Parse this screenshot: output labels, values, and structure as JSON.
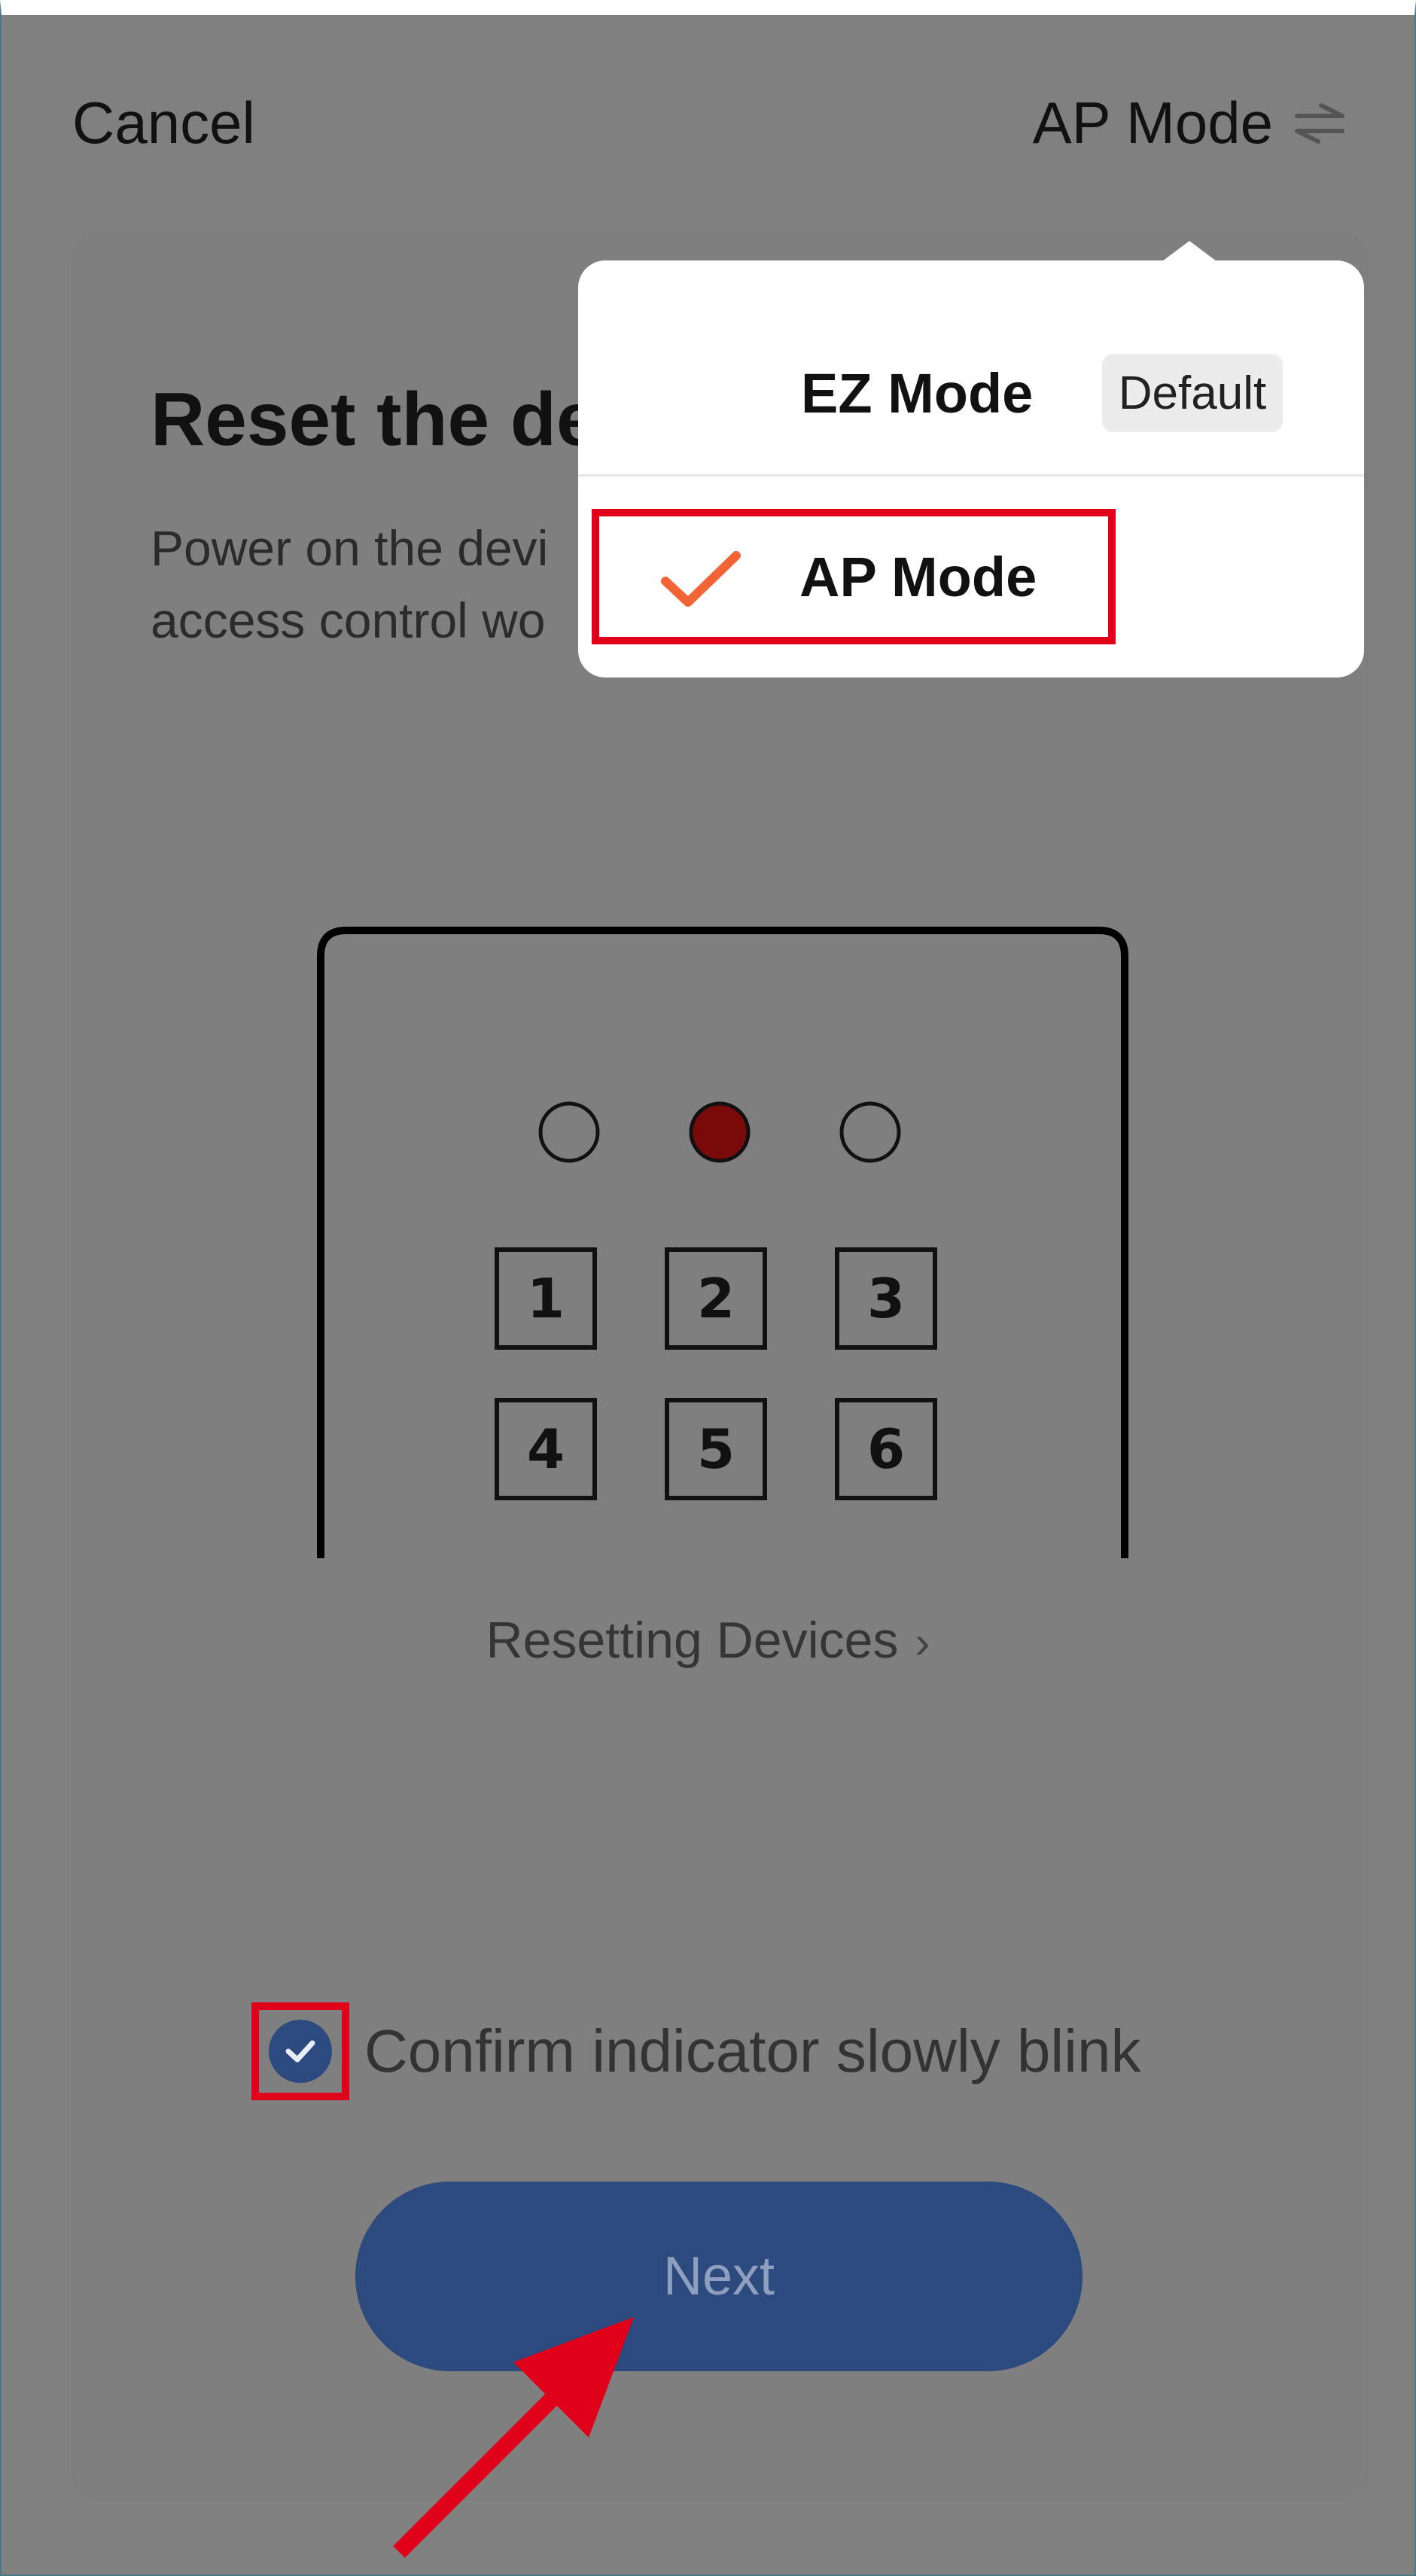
{
  "header": {
    "cancel_label": "Cancel",
    "mode_label": "AP Mode",
    "mode_icon": "swap-arrows-icon"
  },
  "instructions": {
    "title": "Reset the de",
    "description_line1": "Power on the devi",
    "description_line2": "access control wo"
  },
  "device_illustration": {
    "indicators": [
      "off",
      "red",
      "off"
    ],
    "keys": [
      "1",
      "2",
      "3",
      "4",
      "5",
      "6"
    ]
  },
  "reset_link": {
    "label": "Resetting Devices",
    "icon": "chevron-right-icon"
  },
  "confirm": {
    "checked": true,
    "label": "Confirm indicator slowly blink"
  },
  "next_button": {
    "label": "Next"
  },
  "mode_menu": {
    "items": [
      {
        "label": "EZ Mode",
        "badge": "Default",
        "selected": false
      },
      {
        "label": "AP Mode",
        "selected": true
      }
    ]
  },
  "colors": {
    "overlay_gray": "#808080",
    "primary_blue": "#2c4a7d",
    "checkmark_orange": "#f26436",
    "annotation_red": "#e0001a",
    "indicator_red": "#7a0a0a"
  }
}
